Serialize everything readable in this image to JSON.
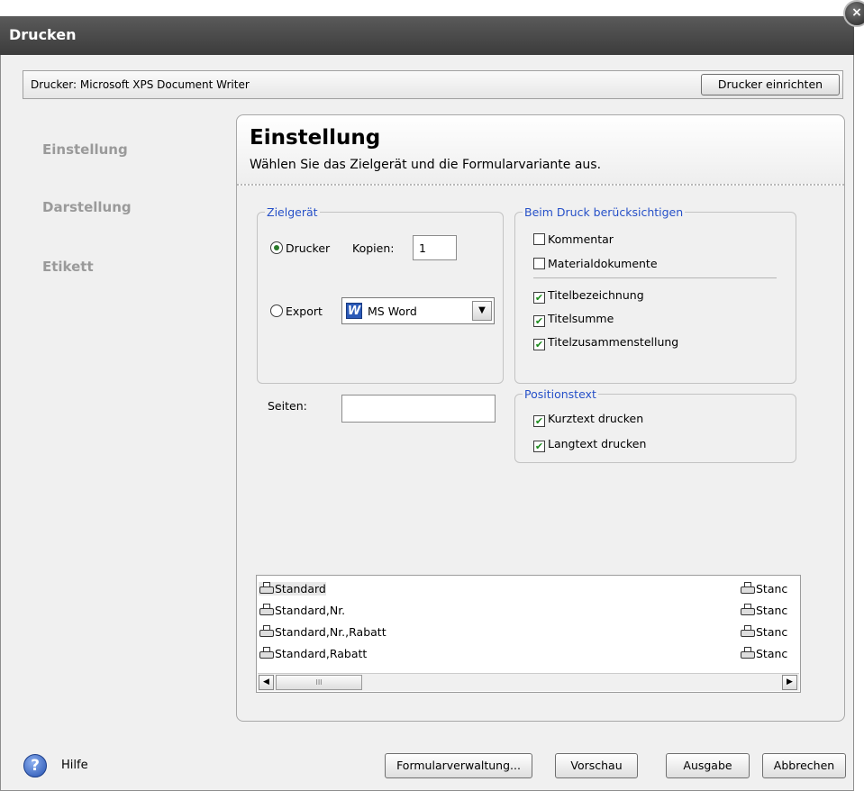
{
  "window": {
    "title": "Drucken",
    "close_glyph": "×"
  },
  "printer": {
    "label": "Drucker: Microsoft XPS Document Writer",
    "setup_button": "Drucker einrichten"
  },
  "nav": {
    "items": [
      {
        "label": "Einstellung"
      },
      {
        "label": "Darstellung"
      },
      {
        "label": "Etikett"
      }
    ]
  },
  "panel": {
    "title": "Einstellung",
    "subtitle": "Wählen Sie das Zielgerät und die Formularvariante aus."
  },
  "zielgeraet": {
    "legend": "Zielgerät",
    "drucker_label": "Drucker",
    "kopien_label": "Kopien:",
    "kopien_value": "1",
    "export_label": "Export",
    "export_format": "MS Word",
    "export_icon": "W",
    "selected": "drucker"
  },
  "seiten": {
    "label": "Seiten:",
    "value": ""
  },
  "beim_druck": {
    "legend": "Beim Druck berücksichtigen",
    "options": [
      {
        "label": "Kommentar",
        "checked": false
      },
      {
        "label": "Materialdokumente",
        "checked": false
      },
      {
        "label": "Titelbezeichnung",
        "checked": true
      },
      {
        "label": "Titelsumme",
        "checked": true
      },
      {
        "label": "Titelzusammenstellung",
        "checked": true
      }
    ]
  },
  "positionstext": {
    "legend": "Positionstext",
    "options": [
      {
        "label": "Kurztext drucken",
        "checked": true
      },
      {
        "label": "Langtext drucken",
        "checked": true
      }
    ]
  },
  "formular_list": {
    "items": [
      "Standard",
      "Standard,Nr.",
      "Standard,Nr.,Rabatt",
      "Standard,Rabatt"
    ],
    "right_items": [
      "Stanc",
      "Stanc",
      "Stanc",
      "Stanc"
    ],
    "scroll_thumb_glyph": "III",
    "scroll_left": "◀",
    "scroll_right": "▶"
  },
  "footer": {
    "help_label": "Hilfe",
    "help_glyph": "?",
    "formularverwaltung": "Formularverwaltung...",
    "vorschau": "Vorschau",
    "ausgabe": "Ausgabe",
    "abbrechen": "Abbrechen"
  },
  "check_glyph": "✔",
  "combo_arrow": "▼"
}
